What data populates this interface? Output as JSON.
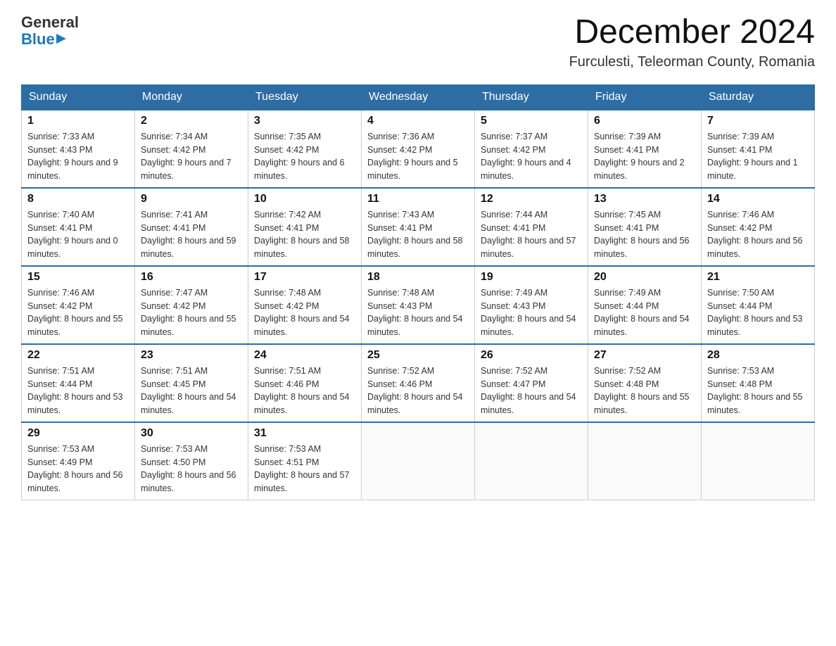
{
  "header": {
    "logo_general": "General",
    "logo_blue": "Blue",
    "title": "December 2024",
    "subtitle": "Furculesti, Teleorman County, Romania"
  },
  "days_of_week": [
    "Sunday",
    "Monday",
    "Tuesday",
    "Wednesday",
    "Thursday",
    "Friday",
    "Saturday"
  ],
  "weeks": [
    [
      {
        "day": "1",
        "sunrise": "7:33 AM",
        "sunset": "4:43 PM",
        "daylight": "9 hours and 9 minutes."
      },
      {
        "day": "2",
        "sunrise": "7:34 AM",
        "sunset": "4:42 PM",
        "daylight": "9 hours and 7 minutes."
      },
      {
        "day": "3",
        "sunrise": "7:35 AM",
        "sunset": "4:42 PM",
        "daylight": "9 hours and 6 minutes."
      },
      {
        "day": "4",
        "sunrise": "7:36 AM",
        "sunset": "4:42 PM",
        "daylight": "9 hours and 5 minutes."
      },
      {
        "day": "5",
        "sunrise": "7:37 AM",
        "sunset": "4:42 PM",
        "daylight": "9 hours and 4 minutes."
      },
      {
        "day": "6",
        "sunrise": "7:39 AM",
        "sunset": "4:41 PM",
        "daylight": "9 hours and 2 minutes."
      },
      {
        "day": "7",
        "sunrise": "7:39 AM",
        "sunset": "4:41 PM",
        "daylight": "9 hours and 1 minute."
      }
    ],
    [
      {
        "day": "8",
        "sunrise": "7:40 AM",
        "sunset": "4:41 PM",
        "daylight": "9 hours and 0 minutes."
      },
      {
        "day": "9",
        "sunrise": "7:41 AM",
        "sunset": "4:41 PM",
        "daylight": "8 hours and 59 minutes."
      },
      {
        "day": "10",
        "sunrise": "7:42 AM",
        "sunset": "4:41 PM",
        "daylight": "8 hours and 58 minutes."
      },
      {
        "day": "11",
        "sunrise": "7:43 AM",
        "sunset": "4:41 PM",
        "daylight": "8 hours and 58 minutes."
      },
      {
        "day": "12",
        "sunrise": "7:44 AM",
        "sunset": "4:41 PM",
        "daylight": "8 hours and 57 minutes."
      },
      {
        "day": "13",
        "sunrise": "7:45 AM",
        "sunset": "4:41 PM",
        "daylight": "8 hours and 56 minutes."
      },
      {
        "day": "14",
        "sunrise": "7:46 AM",
        "sunset": "4:42 PM",
        "daylight": "8 hours and 56 minutes."
      }
    ],
    [
      {
        "day": "15",
        "sunrise": "7:46 AM",
        "sunset": "4:42 PM",
        "daylight": "8 hours and 55 minutes."
      },
      {
        "day": "16",
        "sunrise": "7:47 AM",
        "sunset": "4:42 PM",
        "daylight": "8 hours and 55 minutes."
      },
      {
        "day": "17",
        "sunrise": "7:48 AM",
        "sunset": "4:42 PM",
        "daylight": "8 hours and 54 minutes."
      },
      {
        "day": "18",
        "sunrise": "7:48 AM",
        "sunset": "4:43 PM",
        "daylight": "8 hours and 54 minutes."
      },
      {
        "day": "19",
        "sunrise": "7:49 AM",
        "sunset": "4:43 PM",
        "daylight": "8 hours and 54 minutes."
      },
      {
        "day": "20",
        "sunrise": "7:49 AM",
        "sunset": "4:44 PM",
        "daylight": "8 hours and 54 minutes."
      },
      {
        "day": "21",
        "sunrise": "7:50 AM",
        "sunset": "4:44 PM",
        "daylight": "8 hours and 53 minutes."
      }
    ],
    [
      {
        "day": "22",
        "sunrise": "7:51 AM",
        "sunset": "4:44 PM",
        "daylight": "8 hours and 53 minutes."
      },
      {
        "day": "23",
        "sunrise": "7:51 AM",
        "sunset": "4:45 PM",
        "daylight": "8 hours and 54 minutes."
      },
      {
        "day": "24",
        "sunrise": "7:51 AM",
        "sunset": "4:46 PM",
        "daylight": "8 hours and 54 minutes."
      },
      {
        "day": "25",
        "sunrise": "7:52 AM",
        "sunset": "4:46 PM",
        "daylight": "8 hours and 54 minutes."
      },
      {
        "day": "26",
        "sunrise": "7:52 AM",
        "sunset": "4:47 PM",
        "daylight": "8 hours and 54 minutes."
      },
      {
        "day": "27",
        "sunrise": "7:52 AM",
        "sunset": "4:48 PM",
        "daylight": "8 hours and 55 minutes."
      },
      {
        "day": "28",
        "sunrise": "7:53 AM",
        "sunset": "4:48 PM",
        "daylight": "8 hours and 55 minutes."
      }
    ],
    [
      {
        "day": "29",
        "sunrise": "7:53 AM",
        "sunset": "4:49 PM",
        "daylight": "8 hours and 56 minutes."
      },
      {
        "day": "30",
        "sunrise": "7:53 AM",
        "sunset": "4:50 PM",
        "daylight": "8 hours and 56 minutes."
      },
      {
        "day": "31",
        "sunrise": "7:53 AM",
        "sunset": "4:51 PM",
        "daylight": "8 hours and 57 minutes."
      },
      null,
      null,
      null,
      null
    ]
  ]
}
